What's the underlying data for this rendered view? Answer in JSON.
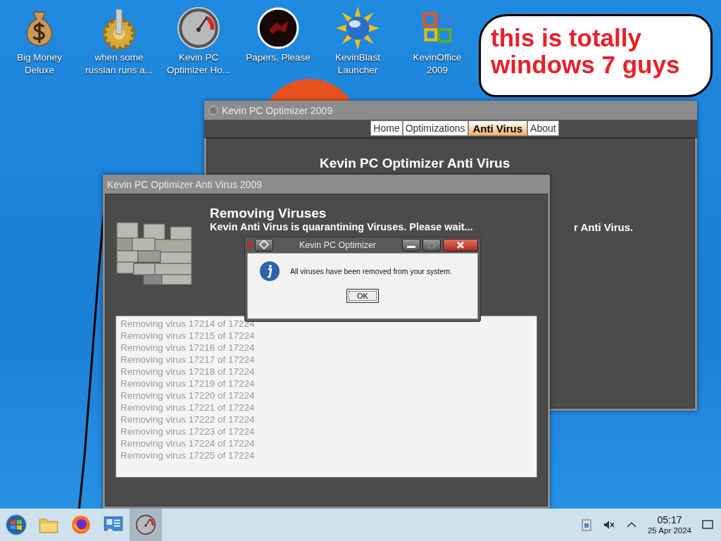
{
  "desktop_icons": [
    {
      "kind": "money-bag",
      "label": "Big Money Deluxe"
    },
    {
      "kind": "gear",
      "label": "when some russian runs a..."
    },
    {
      "kind": "gauge",
      "label": "Kevin PC Optimizer Ho..."
    },
    {
      "kind": "dark-circle",
      "label": "Papers, Please"
    },
    {
      "kind": "sun-globe",
      "label": "KevinBlast Launcher"
    },
    {
      "kind": "office-logo",
      "label": "KevinOffice 2009"
    }
  ],
  "speech_bubble": {
    "text": "this is totally windows 7 guys"
  },
  "main_window": {
    "title": "Kevin PC Optimizer 2009",
    "tabs": [
      {
        "label": "Home",
        "selected": false
      },
      {
        "label": "Optimizations",
        "selected": false
      },
      {
        "label": "Anti Virus",
        "selected": true
      },
      {
        "label": "About",
        "selected": false
      }
    ],
    "heading": "Kevin PC Optimizer Anti Virus",
    "subtitle": "r Anti Virus."
  },
  "antivirus_window": {
    "title": "Kevin PC Optimizer Anti Virus 2009",
    "heading": "Removing Viruses",
    "status": "Kevin Anti Virus is quarantining Viruses. Please wait...",
    "log": [
      "Removing virus 17214 of 17224",
      "Removing virus 17215 of 17224",
      "Removing virus 17216 of 17224",
      "Removing virus 17217 of 17224",
      "Removing virus 17218 of 17224",
      "Removing virus 17219 of 17224",
      "Removing virus 17220 of 17224",
      "Removing virus 17221 of 17224",
      "Removing virus 17222 of 17224",
      "Removing virus 17223 of 17224",
      "Removing virus 17224 of 17224",
      "Removing virus 17225 of 17224"
    ]
  },
  "dialog": {
    "title": "Kevin PC Optimizer",
    "message": "All viruses have been removed from your system.",
    "button": "OK"
  },
  "taskbar": {
    "apps": [
      {
        "kind": "start",
        "active": false
      },
      {
        "kind": "folder",
        "active": false
      },
      {
        "kind": "firefox",
        "active": false
      },
      {
        "kind": "panel",
        "active": false
      },
      {
        "kind": "gauge",
        "active": true
      }
    ],
    "clock": {
      "time": "05:17",
      "date": "25 Apr 2024"
    }
  }
}
